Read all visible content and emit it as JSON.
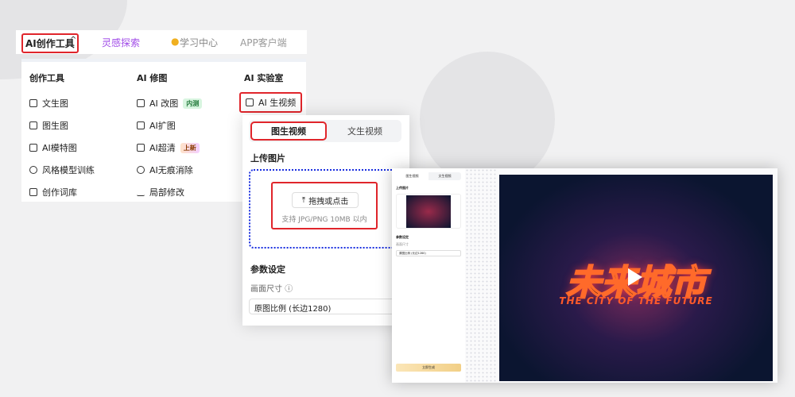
{
  "nav": {
    "items": [
      "AI创作工具",
      "灵感探索",
      "学习中心",
      "APP客户端"
    ]
  },
  "menu": {
    "columns": [
      {
        "title": "创作工具",
        "items": [
          "文生图",
          "图生图",
          "AI模特图",
          "风格模型训练",
          "创作词库"
        ]
      },
      {
        "title": "AI 修图",
        "items": [
          "AI 改图",
          "AI扩图",
          "AI超清",
          "AI无痕消除",
          "局部修改"
        ]
      },
      {
        "title": "AI 实验室",
        "items": [
          "AI 生视频"
        ]
      }
    ],
    "badges": {
      "internal": "内测",
      "new": "上新"
    }
  },
  "panel": {
    "tabs": [
      "图生视频",
      "文生视频"
    ],
    "upload_label": "上传图片",
    "upload_button": "拖拽或点击",
    "upload_hint": "支持 JPG/PNG 10MB 以内",
    "params_label": "参数设定",
    "size_label": "画面尺寸",
    "size_value": "原图比例 (长边1280)"
  },
  "mini": {
    "tabs": [
      "图生视频",
      "文生视频"
    ],
    "upload_label": "上传图片",
    "params_label": "参数设定",
    "size_label": "画面尺寸",
    "size_value": "原图比例 (长边1280)",
    "generate": "立即生成"
  },
  "video": {
    "title": "未来城市",
    "subtitle": "THE CITY OF THE FUTURE"
  }
}
